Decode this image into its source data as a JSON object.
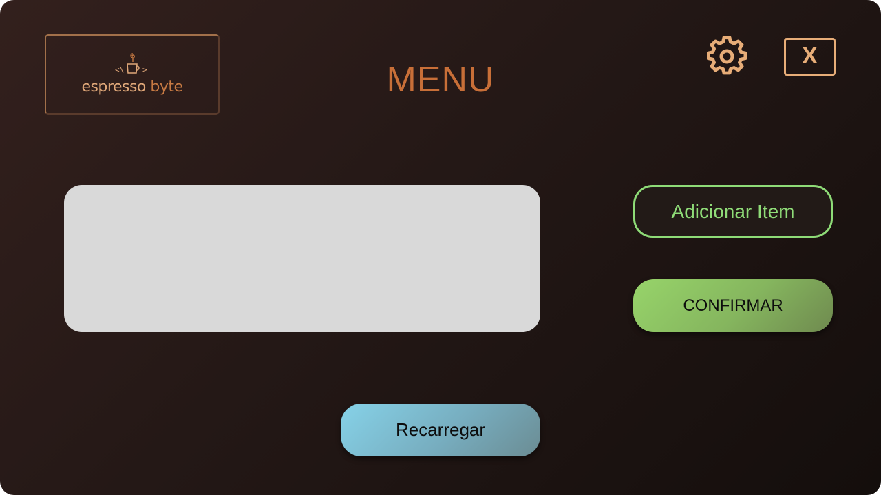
{
  "header": {
    "logo": {
      "text_main": "espresso",
      "text_accent": "byte",
      "code_left": "<\\",
      "code_right": ">"
    },
    "title": "MENU",
    "settings_icon": "gear-icon",
    "close_label": "X"
  },
  "actions": {
    "add_item_label": "Adicionar Item",
    "confirm_label": "CONFIRMAR",
    "reload_label": "Recarregar"
  },
  "colors": {
    "background_dark": "#241816",
    "accent_orange": "#c86f38",
    "accent_peach": "#e7ad78",
    "green": "#8edb77",
    "blue": "#86d2e8",
    "list_bg": "#d9d9d9"
  }
}
